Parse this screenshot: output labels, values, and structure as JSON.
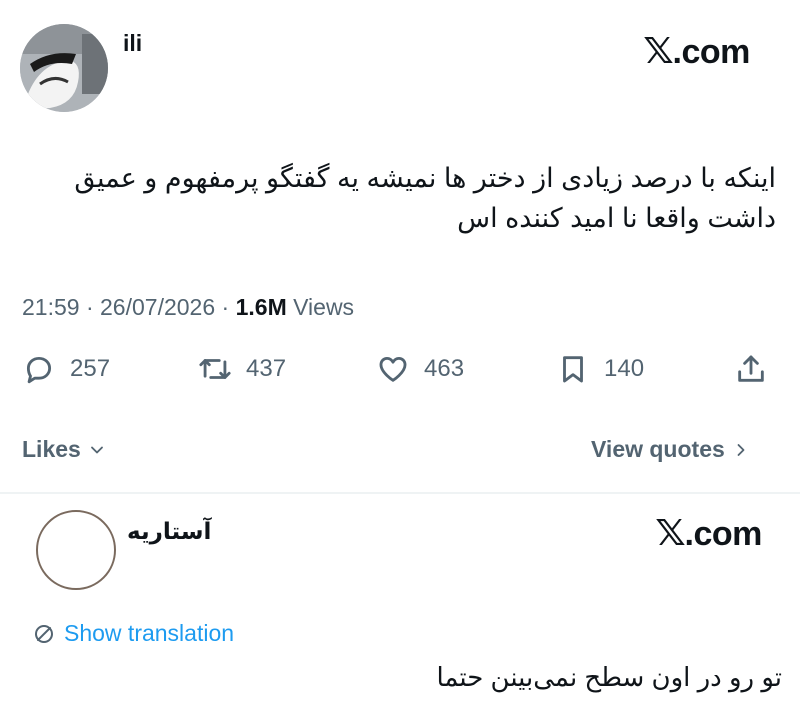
{
  "tweet": {
    "author_name": "ili",
    "source": ".com",
    "text": "اینکه با درصد زیادی از دختر ها نمیشه یه گفتگو پرمفهوم و عمیق داشت واقعا نا امید کننده اس",
    "time": "21:59",
    "separator1": "·",
    "date": "26/07/2026",
    "separator2": "·",
    "views_count": "1.6M",
    "views_label": "Views",
    "stats": {
      "replies": "257",
      "retweets": "437",
      "likes": "463",
      "bookmarks": "140"
    },
    "likes_link": "Likes",
    "quotes_link": "View quotes"
  },
  "reply": {
    "author_name": "آستاریه",
    "source": ".com",
    "translate_label": "Show translation",
    "text": "تو رو در اون سطح نمی‌بینن حتما"
  },
  "icons": [
    "reply-icon",
    "retweet-icon",
    "like-icon",
    "bookmark-icon",
    "share-icon",
    "chevron-down-icon",
    "chevron-right-icon",
    "globe-icon",
    "x-logo-icon"
  ],
  "colors": {
    "text": "#0f1419",
    "muted": "#536471",
    "link": "#1d9bf0",
    "divider": "#eff3f4"
  }
}
